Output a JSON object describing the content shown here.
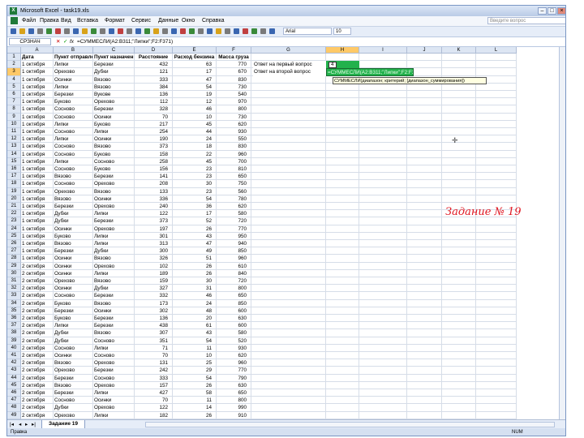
{
  "title": "Microsoft Excel - task19.xls",
  "menu": [
    "Файл",
    "Правка",
    "Вид",
    "Вставка",
    "Формат",
    "Сервис",
    "Данные",
    "Окно",
    "Справка"
  ],
  "help_placeholder": "Введите вопрос",
  "font_name": "Arial",
  "font_size": "10",
  "name_box": "СРЗНАЧ",
  "formula": "=СУММЕСЛИ(A2:B311;\"Липки\";F2:F371)",
  "columns": [
    "A",
    "B",
    "C",
    "D",
    "E",
    "F",
    "G",
    "H",
    "I",
    "J",
    "K",
    "L"
  ],
  "headers": [
    "Дата",
    "Пункт отправления",
    "Пункт назначения",
    "Расстояние",
    "Расход бензина",
    "Масса груза"
  ],
  "rows": [
    [
      "1 октября",
      "Липки",
      "Березки",
      "432",
      "63",
      "770"
    ],
    [
      "1 октября",
      "Орехово",
      "Дубки",
      "121",
      "17",
      "670"
    ],
    [
      "1 октября",
      "Осинки",
      "Вязово",
      "333",
      "47",
      "830"
    ],
    [
      "1 октября",
      "Липки",
      "Вязово",
      "384",
      "54",
      "730"
    ],
    [
      "1 октября",
      "Березки",
      "Вукове",
      "136",
      "19",
      "540"
    ],
    [
      "1 октября",
      "Буково",
      "Орехово",
      "112",
      "12",
      "970"
    ],
    [
      "1 октября",
      "Сосново",
      "Березки",
      "328",
      "46",
      "800"
    ],
    [
      "1 октября",
      "Сосново",
      "Осинки",
      "70",
      "10",
      "730"
    ],
    [
      "1 октября",
      "Липки",
      "Буково",
      "217",
      "45",
      "620"
    ],
    [
      "1 октября",
      "Сосново",
      "Липки",
      "254",
      "44",
      "930"
    ],
    [
      "1 октября",
      "Липки",
      "Осинки",
      "190",
      "24",
      "550"
    ],
    [
      "1 октября",
      "Сосново",
      "Вязово",
      "373",
      "18",
      "830"
    ],
    [
      "1 октября",
      "Сосново",
      "Буково",
      "158",
      "22",
      "960"
    ],
    [
      "1 октября",
      "Липки",
      "Сосново",
      "258",
      "45",
      "700"
    ],
    [
      "1 октября",
      "Сосново",
      "Буково",
      "156",
      "23",
      "810"
    ],
    [
      "1 октября",
      "Вязово",
      "Березки",
      "141",
      "23",
      "650"
    ],
    [
      "1 октября",
      "Сосново",
      "Орехово",
      "208",
      "30",
      "750"
    ],
    [
      "1 октября",
      "Орехово",
      "Вязово",
      "133",
      "23",
      "560"
    ],
    [
      "1 октября",
      "Вязово",
      "Осинки",
      "336",
      "54",
      "780"
    ],
    [
      "1 октября",
      "Березки",
      "Орехово",
      "240",
      "36",
      "620"
    ],
    [
      "1 октября",
      "Дубки",
      "Липки",
      "122",
      "17",
      "580"
    ],
    [
      "1 октября",
      "Дубки",
      "Березки",
      "373",
      "52",
      "720"
    ],
    [
      "1 октября",
      "Осинки",
      "Орехово",
      "197",
      "26",
      "770"
    ],
    [
      "1 октября",
      "Буково",
      "Липки",
      "301",
      "43",
      "950"
    ],
    [
      "1 октября",
      "Вязово",
      "Липки",
      "313",
      "47",
      "940"
    ],
    [
      "1 октября",
      "Березки",
      "Дубки",
      "300",
      "49",
      "850"
    ],
    [
      "1 октября",
      "Осинки",
      "Вязово",
      "326",
      "51",
      "960"
    ],
    [
      "2 октября",
      "Осинки",
      "Орехово",
      "102",
      "26",
      "610"
    ],
    [
      "2 октября",
      "Осинки",
      "Липки",
      "189",
      "26",
      "840"
    ],
    [
      "2 октября",
      "Орехово",
      "Вязово",
      "159",
      "30",
      "720"
    ],
    [
      "2 октября",
      "Осинки",
      "Дубки",
      "327",
      "31",
      "800"
    ],
    [
      "2 октября",
      "Сосново",
      "Березки",
      "332",
      "46",
      "650"
    ],
    [
      "2 октября",
      "Буково",
      "Вязово",
      "173",
      "24",
      "850"
    ],
    [
      "2 октября",
      "Березки",
      "Осинки",
      "302",
      "48",
      "600"
    ],
    [
      "2 октября",
      "Буково",
      "Березки",
      "136",
      "20",
      "630"
    ],
    [
      "2 октября",
      "Липки",
      "Березки",
      "438",
      "61",
      "600"
    ],
    [
      "2 октября",
      "Дубки",
      "Вязово",
      "307",
      "43",
      "580"
    ],
    [
      "2 октября",
      "Дубки",
      "Сосново",
      "351",
      "54",
      "520"
    ],
    [
      "2 октября",
      "Сосново",
      "Липки",
      "71",
      "11",
      "930"
    ],
    [
      "2 октября",
      "Осинки",
      "Сосново",
      "70",
      "10",
      "620"
    ],
    [
      "2 октября",
      "Вязово",
      "Орехово",
      "131",
      "25",
      "960"
    ],
    [
      "2 октября",
      "Орехово",
      "Березки",
      "242",
      "29",
      "770"
    ],
    [
      "2 октября",
      "Березки",
      "Сосново",
      "333",
      "54",
      "790"
    ],
    [
      "2 октября",
      "Вязово",
      "Орехово",
      "157",
      "26",
      "630"
    ],
    [
      "2 октября",
      "Березки",
      "Липки",
      "427",
      "58",
      "650"
    ],
    [
      "2 октября",
      "Сосново",
      "Осинки",
      "70",
      "11",
      "800"
    ],
    [
      "2 октября",
      "Дубки",
      "Орехово",
      "122",
      "14",
      "990"
    ],
    [
      "2 октября",
      "Орехово",
      "Липки",
      "182",
      "26",
      "910"
    ]
  ],
  "g_labels": [
    "Ответ на первый вопрос",
    "Ответ на второй вопрос"
  ],
  "h2_value": "4",
  "h3_formula": "=СУММЕСЛИ(A2:B311;\"Липки\";F2:F371)",
  "tooltip": "СУММЕСЛИ(диапазон; критерий; [диапазон_суммирования])",
  "task_label": "Задание № 19",
  "sheet_tab": "Задание 19",
  "status_left": "Правка",
  "status_right": "NUM",
  "colors": {
    "accent": "#22b14c",
    "task": "#e0141e",
    "selected_header": "#ffc967"
  }
}
